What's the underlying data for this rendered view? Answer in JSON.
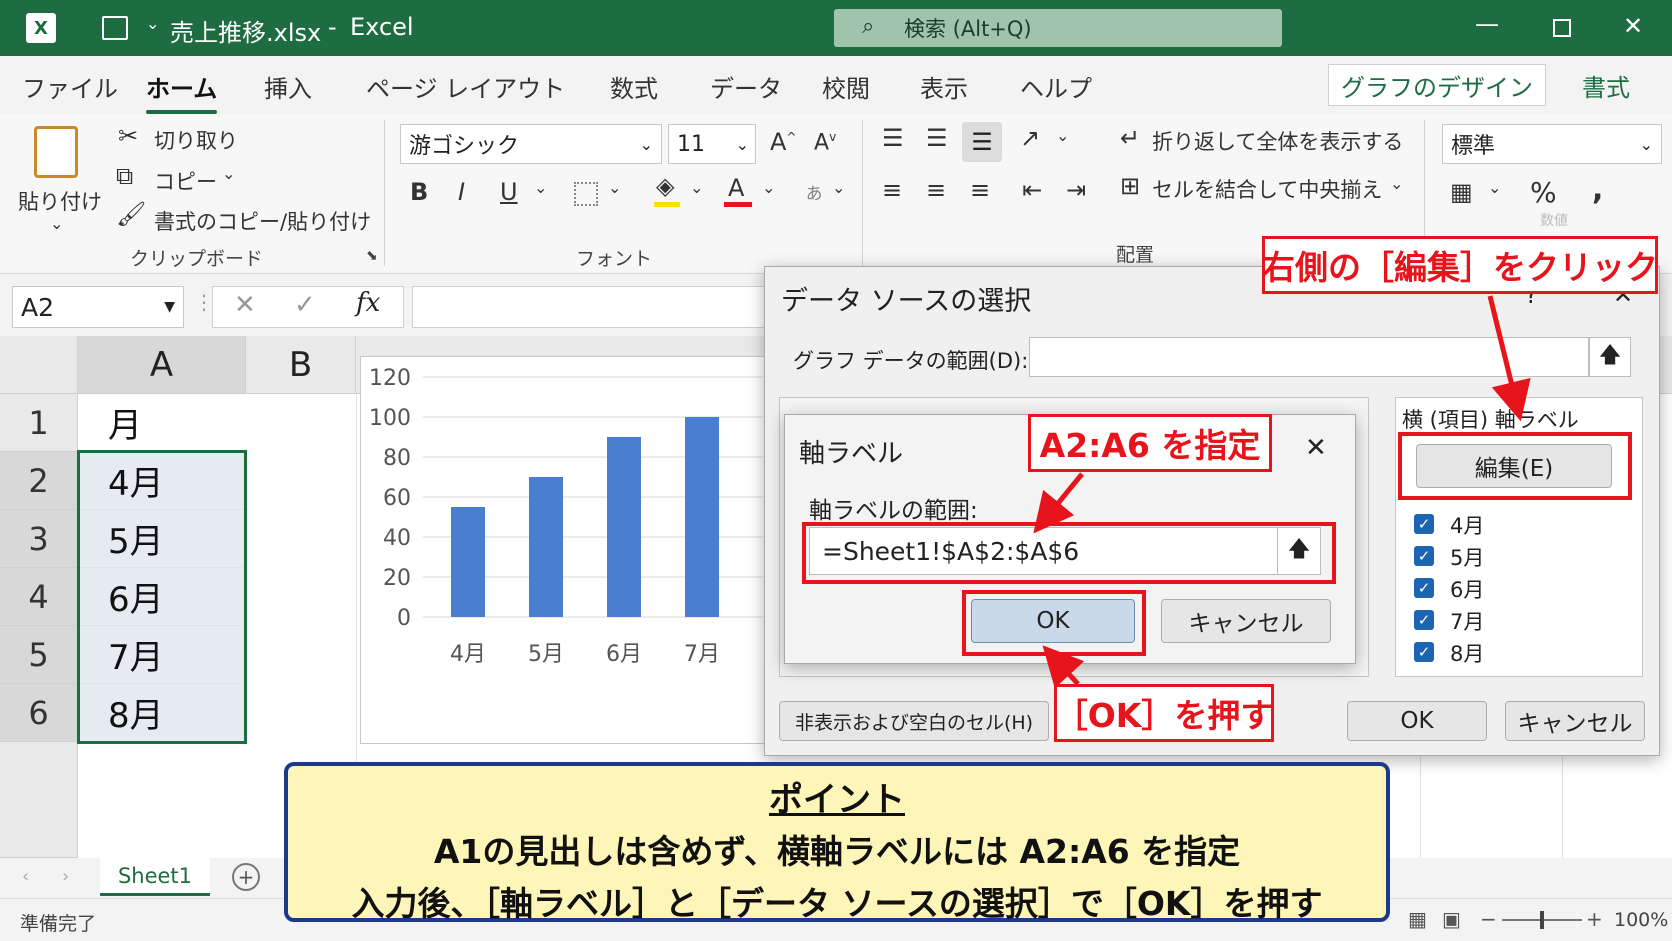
{
  "titlebar": {
    "filename": "売上推移.xlsx",
    "separator": "-",
    "app": "Excel",
    "search": "検索 (Alt+Q)"
  },
  "tabs": [
    "ファイル",
    "ホーム",
    "挿入",
    "ページ レイアウト",
    "数式",
    "データ",
    "校閲",
    "表示",
    "ヘルプ"
  ],
  "context_tabs": [
    "グラフのデザイン",
    "書式"
  ],
  "ribbon": {
    "paste": "貼り付け",
    "cut": "切り取り",
    "copy": "コピー",
    "format_painter": "書式のコピー/貼り付け",
    "clipboard_group": "クリップボード",
    "font_name": "游ゴシック",
    "font_size": "11",
    "font_group": "フォント",
    "wrap_text": "折り返して全体を表示する",
    "merge_center": "セルを結合して中央揃え",
    "alignment_group": "配置",
    "number_format": "標準",
    "number_group": "数値"
  },
  "formula_bar": {
    "name_box": "A2",
    "fx": "fx"
  },
  "grid": {
    "columns": [
      "A",
      "B"
    ],
    "rows": [
      {
        "num": "1",
        "a": "月"
      },
      {
        "num": "2",
        "a": "4月"
      },
      {
        "num": "3",
        "a": "5月"
      },
      {
        "num": "4",
        "a": "6月"
      },
      {
        "num": "5",
        "a": "7月"
      },
      {
        "num": "6",
        "a": "8月"
      }
    ]
  },
  "chart_data": {
    "type": "bar",
    "categories": [
      "4月",
      "5月",
      "6月",
      "7月"
    ],
    "values": [
      55,
      70,
      90,
      100
    ],
    "ylim": [
      0,
      120
    ],
    "yticks": [
      "120",
      "100",
      "80",
      "60",
      "40",
      "20",
      "0"
    ],
    "bar_color": "#4a7fcf"
  },
  "source_dialog": {
    "title": "データ ソースの選択",
    "help": "?",
    "close": "✕",
    "range_label": "グラフ データの範囲(D):",
    "axis_header": "横 (項目) 軸ラベル",
    "edit_button": "編集(E)",
    "items": [
      "4月",
      "5月",
      "6月",
      "7月",
      "8月"
    ],
    "hidden_cells_button": "非表示および空白のセル(H)",
    "ok": "OK",
    "cancel": "キャンセル"
  },
  "axis_dialog": {
    "title": "軸ラベル",
    "close": "✕",
    "range_label": "軸ラベルの範囲:",
    "range_value": "=Sheet1!$A$2:$A$6",
    "ok": "OK",
    "cancel": "キャンセル"
  },
  "callouts": {
    "edit": "右側の［編集］をクリック",
    "range": "A2:A6 を指定",
    "ok": "［OK］を押す"
  },
  "point": {
    "heading": "ポイント",
    "line1": "A1の見出しは含めず、横軸ラベルには A2:A6 を指定",
    "line2": "入力後、［軸ラベル］と［データ ソースの選択］で［OK］を押す"
  },
  "sheet": {
    "tab": "Sheet1",
    "add": "+"
  },
  "status": {
    "ready": "準備完了",
    "zoom": "100%"
  },
  "colors": {
    "excel_green": "#1e6c41",
    "callout_red": "#e8141c",
    "point_bg": "#fdf6b8",
    "point_border": "#1d3a8a"
  }
}
